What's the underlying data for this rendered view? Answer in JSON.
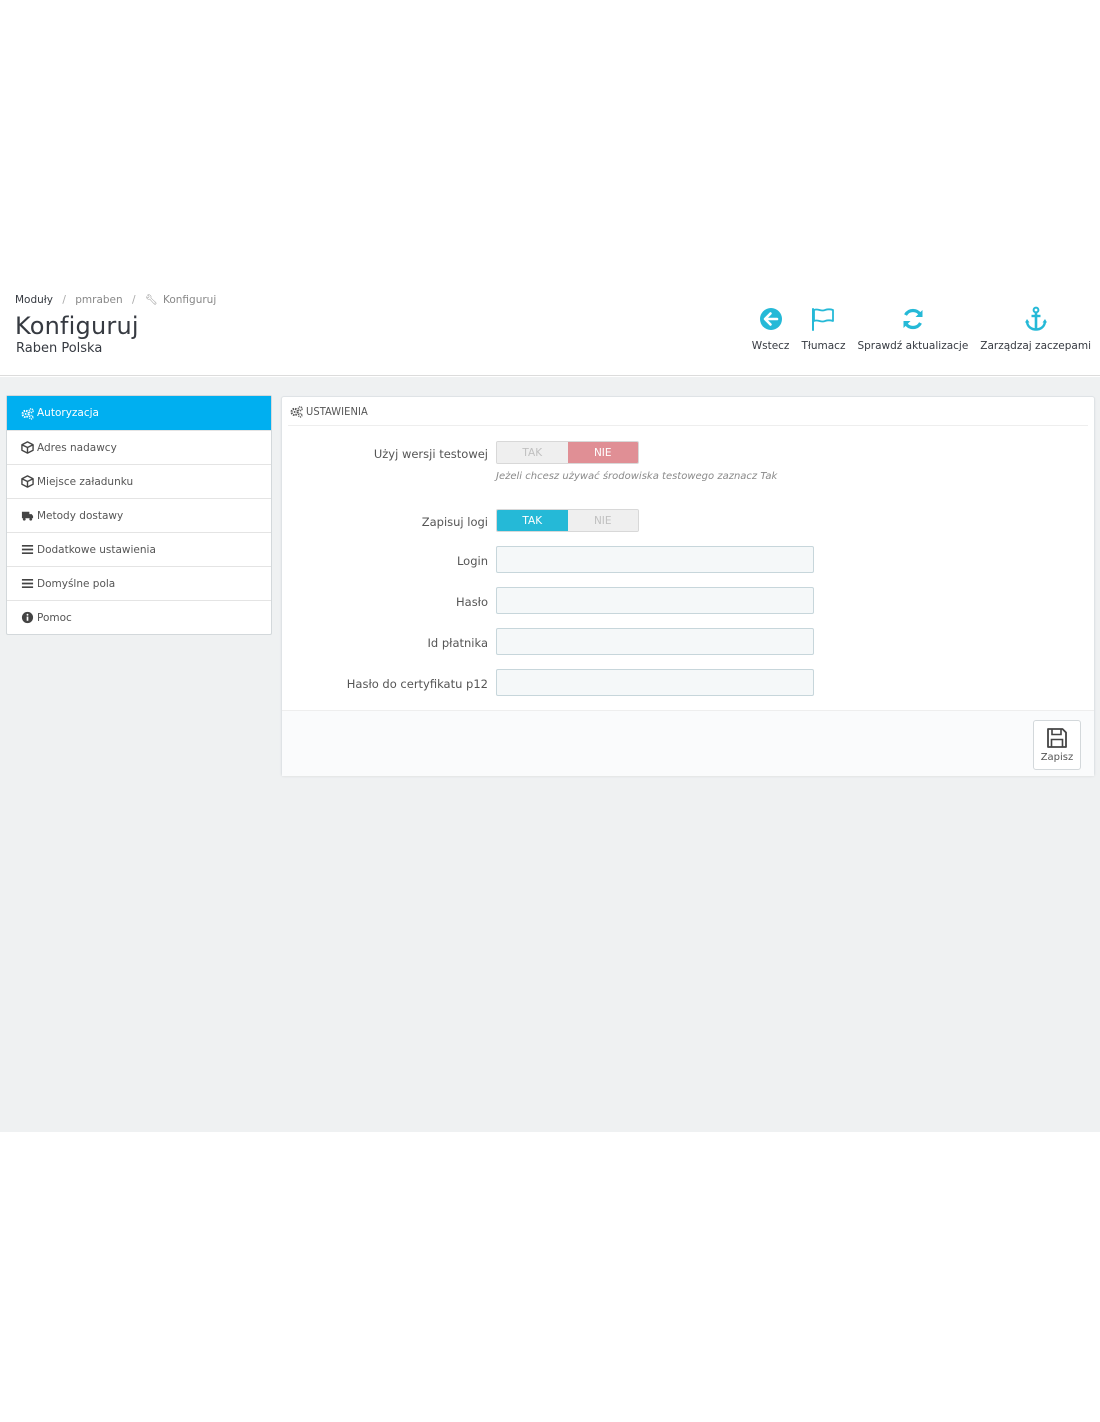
{
  "breadcrumb": {
    "items": [
      "Moduły",
      "pmraben",
      "Konfiguruj"
    ]
  },
  "header": {
    "title": "Konfiguruj",
    "subtitle": "Raben Polska"
  },
  "toolbar": {
    "back_label": "Wstecz",
    "translate_label": "Tłumacz",
    "check_updates_label": "Sprawdź aktualizacje",
    "manage_hooks_label": "Zarządzaj zaczepami"
  },
  "sidebar": {
    "items": [
      {
        "label": "Autoryzacja",
        "icon": "cogs-icon",
        "active": true
      },
      {
        "label": "Adres nadawcy",
        "icon": "cube-icon",
        "active": false
      },
      {
        "label": "Miejsce załadunku",
        "icon": "cube-icon",
        "active": false
      },
      {
        "label": "Metody dostawy",
        "icon": "truck-icon",
        "active": false
      },
      {
        "label": "Dodatkowe ustawienia",
        "icon": "list-icon",
        "active": false
      },
      {
        "label": "Domyślne pola",
        "icon": "list-icon",
        "active": false
      },
      {
        "label": "Pomoc",
        "icon": "info-icon",
        "active": false
      }
    ]
  },
  "panel": {
    "heading": "USTAWIENIA",
    "test_mode": {
      "label": "Użyj wersji testowej",
      "yes_label": "TAK",
      "no_label": "NIE",
      "selected": "NIE",
      "help": "Jeżeli chcesz używać środowiska testowego zaznacz Tak"
    },
    "logs": {
      "label": "Zapisuj logi",
      "yes_label": "TAK",
      "no_label": "NIE",
      "selected": "TAK"
    },
    "fields": {
      "login_label": "Login",
      "password_label": "Hasło",
      "payer_id_label": "Id płatnika",
      "cert_password_label": "Hasło do certyfikatu p12"
    },
    "save_label": "Zapisz"
  },
  "colors": {
    "primary": "#25b9d7",
    "sidebar_active": "#00aff0",
    "switch_no": "#e08f95",
    "content_bg": "#eff1f2"
  }
}
